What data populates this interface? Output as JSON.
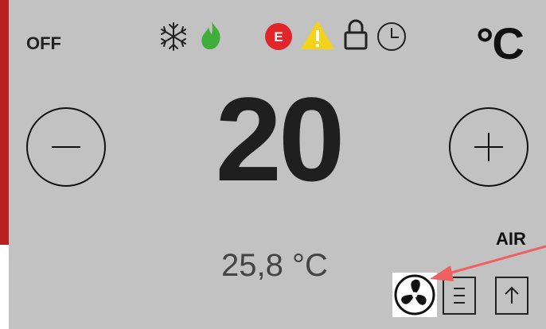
{
  "status": {
    "power_state": "OFF",
    "unit": "°C",
    "error_badge": "E"
  },
  "setpoint": {
    "value": "20"
  },
  "room": {
    "temperature": "25,8 °C"
  },
  "mode": {
    "label": "AIR"
  },
  "icons": [
    "snowflake-icon",
    "flame-icon",
    "error-icon",
    "warning-icon",
    "lock-icon",
    "clock-icon",
    "minus-icon",
    "plus-icon",
    "fan-icon",
    "menu-icon",
    "up-arrow-icon"
  ],
  "colors": {
    "panel": "#c2c2c2",
    "edge": "#b8201e",
    "error": "#e0262a",
    "warning": "#f4d11a",
    "flame": "#3fae3a",
    "annotation_arrow": "#f06060"
  }
}
